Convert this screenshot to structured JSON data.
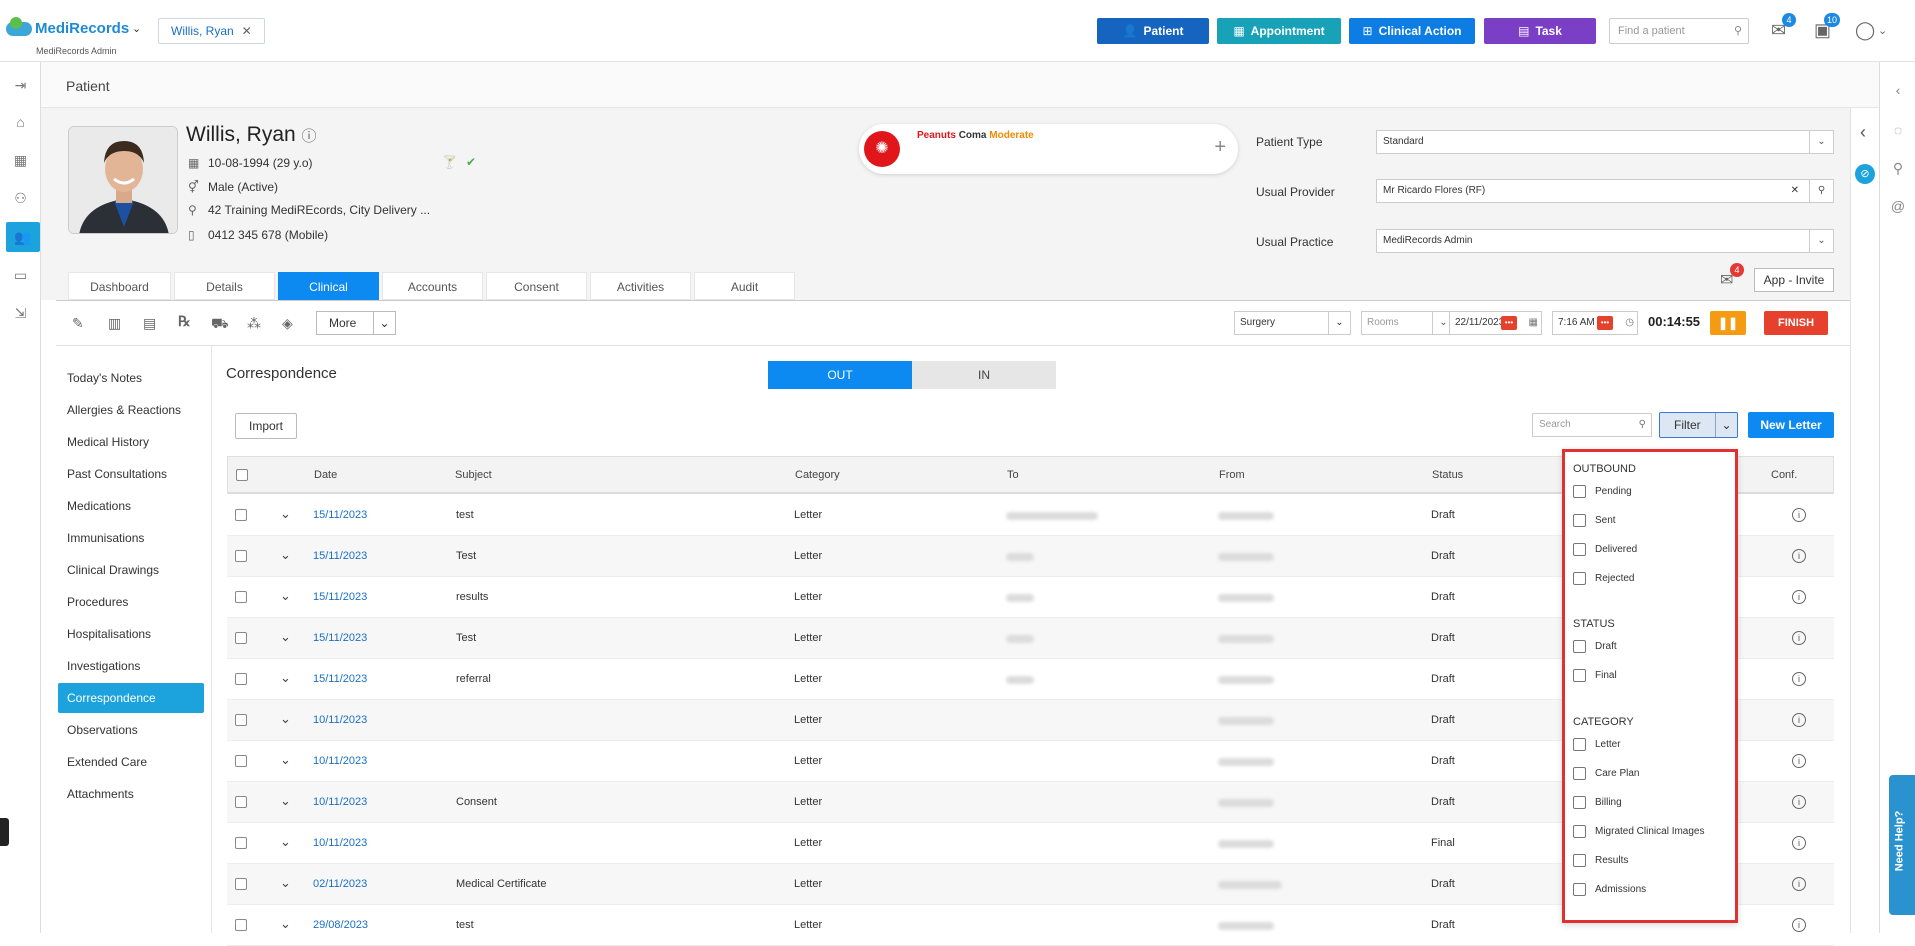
{
  "header": {
    "brand": "MediRecords",
    "brand_sub": "MediRecords Admin",
    "patient_tab": "Willis, Ryan",
    "buttons": {
      "patient": "Patient",
      "appointment": "Appointment",
      "clinical_action": "Clinical Action",
      "task": "Task"
    },
    "find_placeholder": "Find a patient",
    "mail_badge": "4",
    "tasks_badge": "10"
  },
  "breadcrumb": "Patient",
  "patient": {
    "name": "Willis, Ryan",
    "dob": "10-08-1994 (29 y.o)",
    "gender": "Male (Active)",
    "address": "42 Training MediREcords, City Delivery ...",
    "phone": "0412 345 678 (Mobile)",
    "allergy_name": "Peanuts",
    "allergy_reaction": "Coma",
    "allergy_severity": "Moderate"
  },
  "patient_fields": {
    "type_label": "Patient Type",
    "type_value": "Standard",
    "provider_label": "Usual Provider",
    "provider_value": "Mr Ricardo Flores (RF)",
    "practice_label": "Usual Practice",
    "practice_value": "MediRecords Admin"
  },
  "tabs": [
    "Dashboard",
    "Details",
    "Clinical",
    "Accounts",
    "Consent",
    "Activities",
    "Audit"
  ],
  "app_invite": "App - Invite",
  "invite_badge": "4",
  "toolbar": {
    "more": "More",
    "location": "Surgery",
    "rooms": "Rooms",
    "date": "22/11/2023",
    "time": "7:16 AM",
    "timer": "00:14:55",
    "finish": "FINISH"
  },
  "sidenav": [
    "Today's Notes",
    "Allergies & Reactions",
    "Medical History",
    "Past Consultations",
    "Medications",
    "Immunisations",
    "Clinical Drawings",
    "Procedures",
    "Hospitalisations",
    "Investigations",
    "Correspondence",
    "Observations",
    "Extended Care",
    "Attachments"
  ],
  "correspondence": {
    "title": "Correspondence",
    "out_label": "OUT",
    "in_label": "IN",
    "import_label": "Import",
    "search_placeholder": "Search",
    "filter_label": "Filter",
    "new_letter_label": "New Letter"
  },
  "table": {
    "columns": {
      "date": "Date",
      "subject": "Subject",
      "category": "Category",
      "to": "To",
      "from": "From",
      "status": "Status",
      "conf": "Conf."
    },
    "rows": [
      {
        "date": "15/11/2023",
        "subject": "test",
        "category": "Letter",
        "status": "Draft"
      },
      {
        "date": "15/11/2023",
        "subject": "Test",
        "category": "Letter",
        "status": "Draft"
      },
      {
        "date": "15/11/2023",
        "subject": "results",
        "category": "Letter",
        "status": "Draft"
      },
      {
        "date": "15/11/2023",
        "subject": "Test",
        "category": "Letter",
        "status": "Draft"
      },
      {
        "date": "15/11/2023",
        "subject": "referral",
        "category": "Letter",
        "status": "Draft"
      },
      {
        "date": "10/11/2023",
        "subject": "",
        "category": "Letter",
        "status": "Draft"
      },
      {
        "date": "10/11/2023",
        "subject": "",
        "category": "Letter",
        "status": "Draft"
      },
      {
        "date": "10/11/2023",
        "subject": "Consent",
        "category": "Letter",
        "status": "Draft"
      },
      {
        "date": "10/11/2023",
        "subject": "",
        "category": "Letter",
        "status": "Final"
      },
      {
        "date": "02/11/2023",
        "subject": "Medical Certificate",
        "category": "Letter",
        "status": "Draft"
      },
      {
        "date": "29/08/2023",
        "subject": "test",
        "category": "Letter",
        "status": "Draft"
      }
    ]
  },
  "filter_dropdown": {
    "outbound_heading": "OUTBOUND",
    "outbound": [
      "Pending",
      "Sent",
      "Delivered",
      "Rejected"
    ],
    "status_heading": "STATUS",
    "status": [
      "Draft",
      "Final"
    ],
    "category_heading": "CATEGORY",
    "category": [
      "Letter",
      "Care Plan",
      "Billing",
      "Migrated Clinical Images",
      "Results",
      "Admissions"
    ]
  },
  "need_help": "Need Help?",
  "colors": {
    "primary": "#0d8af2",
    "nav_active": "#1ca3dd",
    "appointment": "#17a2b8",
    "task": "#7b3fc6",
    "finish": "#e5412d",
    "pause": "#f59b12",
    "allergy": "#e0161b"
  }
}
